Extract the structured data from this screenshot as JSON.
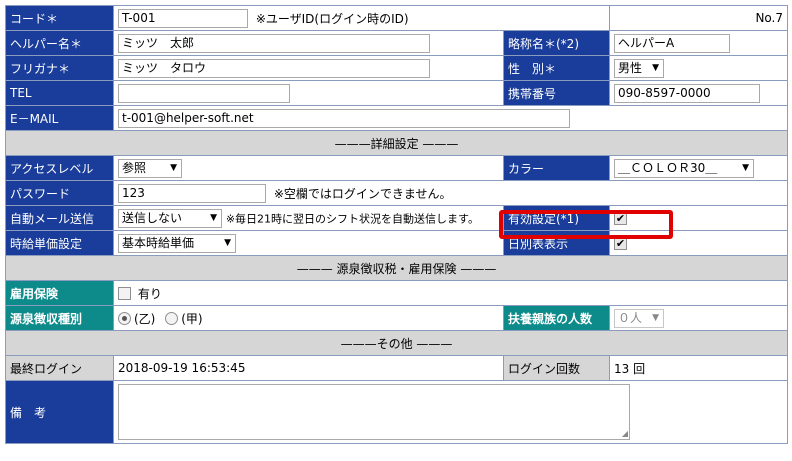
{
  "code": {
    "label": "コード＊",
    "value": "T-001",
    "note": "※ユーザID(ログイン時のID)",
    "no": "No.7"
  },
  "helper_name": {
    "label": "ヘルパー名＊",
    "value": "ミッツ　太郎"
  },
  "short_name": {
    "label": "略称名＊(*2)",
    "value": "ヘルパーA"
  },
  "furigana": {
    "label": "フリガナ＊",
    "value": "ミッツ　タロウ"
  },
  "gender": {
    "label": "性　別＊",
    "value": "男性"
  },
  "tel": {
    "label": "TEL",
    "value": ""
  },
  "mobile": {
    "label": "携帯番号",
    "value": "090-8597-0000"
  },
  "email": {
    "label": "E－MAIL",
    "value": "t-001@helper-soft.net"
  },
  "section_detail": "———詳細設定 ———",
  "access_level": {
    "label": "アクセスレベル",
    "value": "参照"
  },
  "color": {
    "label": "カラー",
    "value": "＿ＣＯＬＯＲ30＿"
  },
  "password": {
    "label": "パスワード",
    "value": "123",
    "note": "※空欄ではログインできません。"
  },
  "auto_mail": {
    "label": "自動メール送信",
    "value": "送信しない",
    "note": "※毎日21時に翌日のシフト状況を自動送信します。"
  },
  "valid_setting": {
    "label": "有効設定(*1)",
    "checked": true
  },
  "hourly_wage": {
    "label": "時給単価設定",
    "value": "基本時給単価"
  },
  "daily_table": {
    "label": "日別表表示",
    "checked": true
  },
  "section_tax": "——— 源泉徴収税・雇用保険 ———",
  "employment_insurance": {
    "label": "雇用保険",
    "option": "有り",
    "checked": false
  },
  "withholding_type": {
    "label": "源泉徴収種別",
    "options": [
      "(乙)",
      "(甲)"
    ],
    "selected": 0
  },
  "dependents": {
    "label": "扶養親族の人数",
    "value": "０人"
  },
  "section_other": "———その他 ———",
  "last_login": {
    "label": "最終ログイン",
    "value": "2018-09-19 16:53:45"
  },
  "login_count": {
    "label": "ログイン回数",
    "value": "13 回"
  },
  "remarks": {
    "label": "備　考",
    "value": ""
  },
  "colors": {
    "label_bg": "#1a3c9a",
    "teal_bg": "#0d8a8a",
    "section_bg": "#d6d6d6",
    "highlight": "#e00000"
  },
  "icons": {
    "select": "chevron-down-icon",
    "check": "checkmark-icon",
    "resize": "resize-grip-icon"
  },
  "glyphs": {
    "arrow": "▼",
    "check": "✔",
    "grip": "◢"
  }
}
